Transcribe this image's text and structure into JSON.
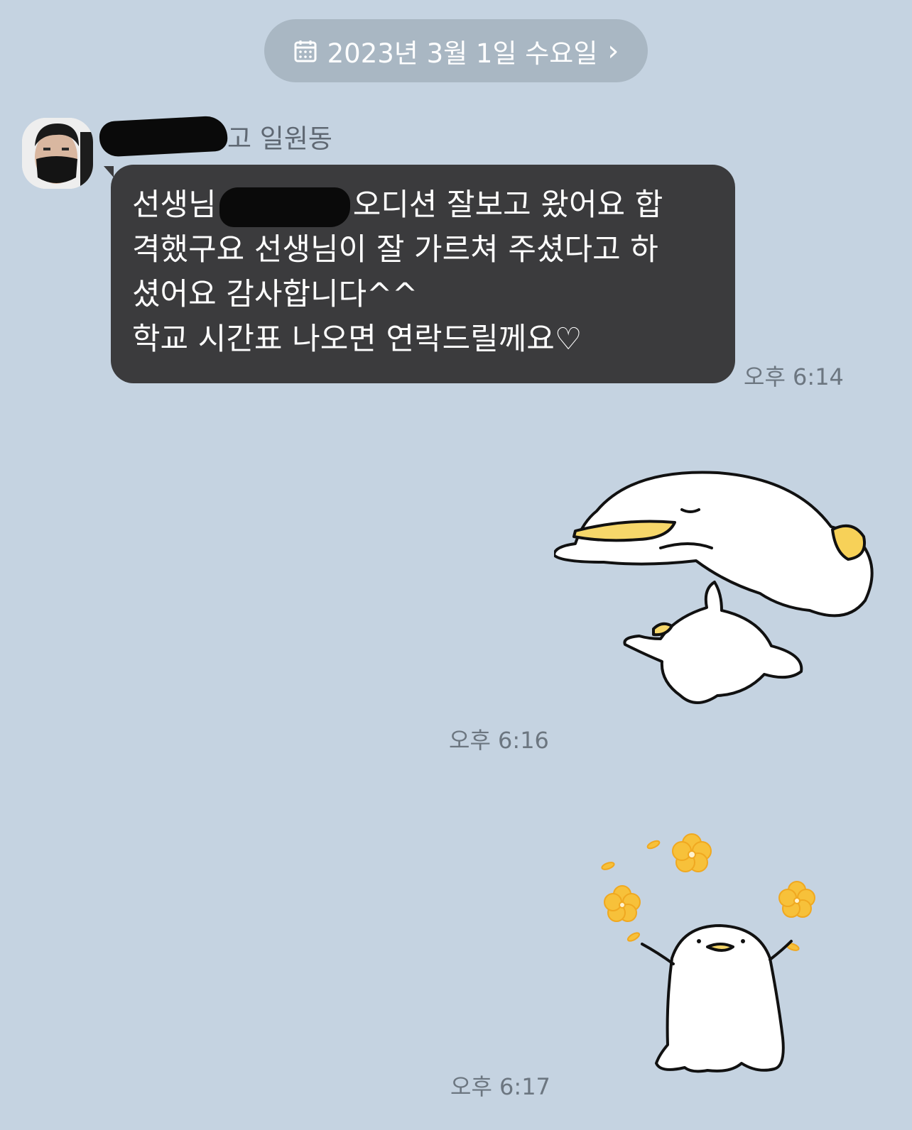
{
  "date_header": {
    "label": "2023년 3월 1일 수요일",
    "icon": "calendar-icon",
    "chevron": "›"
  },
  "sender": {
    "name_visible": "고 일원동",
    "avatar": "avatar-photo"
  },
  "messages": [
    {
      "type": "text",
      "lines": {
        "l1_before": "선생님",
        "l1_after": "오디션 잘보고 왔어요 합",
        "l2": "격했구요 선생님이 잘 가르쳐 주셨다고 하",
        "l3": "셨어요  감사합니다^^",
        "l4": "학교 시간표 나오면 연락드릴께요♡"
      },
      "time": "오후 6:14"
    },
    {
      "type": "sticker",
      "sticker": "duck-and-rabbit-sticker",
      "time": "오후 6:16"
    },
    {
      "type": "sticker",
      "sticker": "duck-with-flowers-sticker",
      "time": "오후 6:17"
    }
  ]
}
